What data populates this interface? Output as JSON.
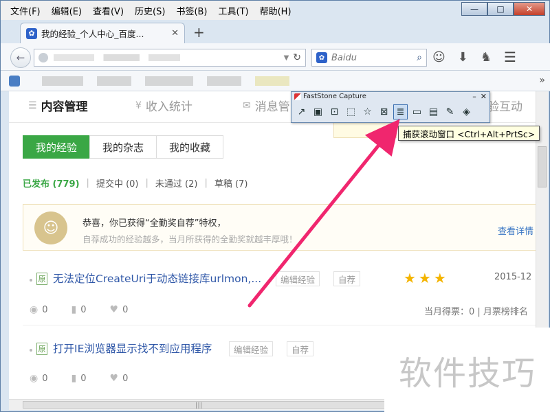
{
  "menubar": {
    "items": [
      "文件(F)",
      "编辑(E)",
      "查看(V)",
      "历史(S)",
      "书签(B)",
      "工具(T)",
      "帮助(H)"
    ]
  },
  "window_controls": {
    "minimize": "—",
    "maximize": "□",
    "close": "✕"
  },
  "tab": {
    "title": "我的经验_个人中心_百度...",
    "close": "✕",
    "new": "+"
  },
  "navbar": {
    "search_placeholder": "Baidu"
  },
  "content_tabs": [
    {
      "label": "内容管理",
      "icon": "☰"
    },
    {
      "label": "收入统计",
      "icon": "¥"
    },
    {
      "label": "消息管",
      "icon": "✉"
    },
    {
      "label": "验互动",
      "icon": ""
    }
  ],
  "subtabs": [
    "我的经验",
    "我的杂志",
    "我的收藏"
  ],
  "filters": [
    {
      "label": "已发布 (779)",
      "active": true
    },
    {
      "label": "提交中 (0)",
      "active": false
    },
    {
      "label": "未通过 (2)",
      "active": false
    },
    {
      "label": "草稿 (7)",
      "active": false
    }
  ],
  "notice": {
    "title": "恭喜，你已获得“全勤奖自荐”特权，",
    "subtitle": "自荐成功的经验越多，当月所获得的全勤奖就越丰厚哦！",
    "link": "查看详情"
  },
  "items": [
    {
      "badge": "原",
      "title": "无法定位CreateUri于动态链接库urlmon,...",
      "edit": "编辑经验",
      "self": "自荐",
      "stars": "★★★",
      "date": "2015-12",
      "views": "0",
      "votes": "0",
      "likes": "0",
      "ranking": "当月得票：0 | 月票榜排名"
    },
    {
      "badge": "原",
      "title": "打开IE浏览器显示找不到应用程序",
      "edit": "编辑经验",
      "self": "自荐",
      "views": "0",
      "votes": "0",
      "likes": "0"
    }
  ],
  "faststone": {
    "title": "FastStone Capture",
    "tooltip": "捕获滚动窗口 <Ctrl+Alt+PrtSc>"
  },
  "watermark": "软件技巧",
  "colors": {
    "accent_green": "#3aa745",
    "link_blue": "#3058a8",
    "arrow_pink": "#f0266e",
    "star": "#f4b400"
  }
}
